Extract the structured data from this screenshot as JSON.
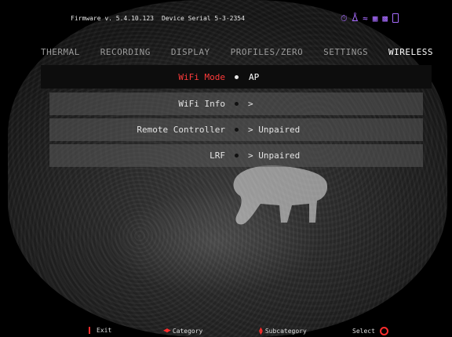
{
  "status_bar": {
    "firmware": "Firmware v. 5.4.10.123",
    "device_serial": "Device Serial 5-3-2354",
    "icons": [
      "timer-icon",
      "bluetooth-icon",
      "wifi-icon",
      "sd-card-icon",
      "video-icon",
      "battery-icon"
    ],
    "icon_color": "#a86cff"
  },
  "tabs": [
    {
      "label": "THERMAL",
      "active": false
    },
    {
      "label": "RECORDING",
      "active": false
    },
    {
      "label": "DISPLAY",
      "active": false
    },
    {
      "label": "PROFILES/ZERO",
      "active": false
    },
    {
      "label": "SETTINGS",
      "active": false
    },
    {
      "label": "WIRELESS",
      "active": true
    }
  ],
  "menu": [
    {
      "label": "WiFi Mode",
      "value": "AP",
      "selected": true
    },
    {
      "label": "WiFi Info",
      "value": ">",
      "selected": false
    },
    {
      "label": "Remote Controller",
      "value": "> Unpaired",
      "selected": false
    },
    {
      "label": "LRF",
      "value": "> Unpaired",
      "selected": false
    }
  ],
  "hints": {
    "exit": "Exit",
    "category": "Category",
    "subcategory": "Subcategory",
    "select": "Select"
  },
  "colors": {
    "accent": "#ff2d2d",
    "selected_label": "#ff3b3b"
  }
}
